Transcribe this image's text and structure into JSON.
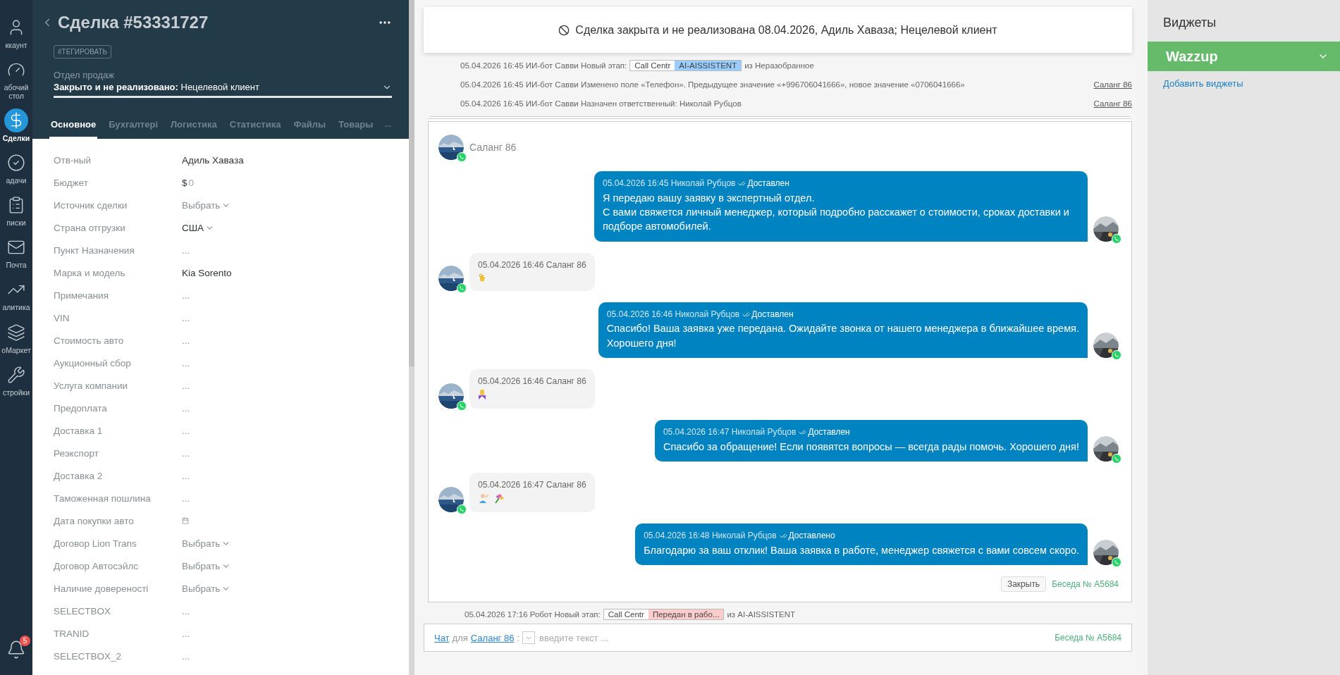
{
  "nav": {
    "items": [
      {
        "kind": "account",
        "label": "ккаунт",
        "selected": false
      },
      {
        "kind": "dashboard",
        "label": "абочий стол",
        "selected": false
      },
      {
        "kind": "deals",
        "label": "Сделки",
        "selected": true
      },
      {
        "kind": "tasks",
        "label": "адачи",
        "selected": false
      },
      {
        "kind": "lists",
        "label": "писки",
        "selected": false
      },
      {
        "kind": "mail",
        "label": "Почта",
        "selected": false
      },
      {
        "kind": "analytics",
        "label": "алитика",
        "selected": false
      },
      {
        "kind": "market",
        "label": "оМаркет",
        "selected": false
      },
      {
        "kind": "settings",
        "label": "стройки",
        "selected": false
      }
    ],
    "notifications": {
      "badge": "5"
    }
  },
  "deal": {
    "title": "Сделка #53331727",
    "tag_button": "#ТЕГИРОВАТЬ",
    "pipeline": "Отдел продаж",
    "status": "**Закрыто и не реализовано:** Нецелевой клиент",
    "tabs": [
      {
        "label": "Основное",
        "selected": true
      },
      {
        "label": "Бухгалтері",
        "selected": false
      },
      {
        "label": "Логистика",
        "selected": false
      },
      {
        "label": "Статистика",
        "selected": false
      },
      {
        "label": "Файлы",
        "selected": false
      },
      {
        "label": "Товары",
        "selected": false
      }
    ],
    "fields": [
      {
        "label": "Отв-ный",
        "kind": "text",
        "value": "Адиль Хаваза"
      },
      {
        "label": "Бюджет",
        "kind": "money",
        "currency": "$",
        "value": "0"
      },
      {
        "label": "Источник сделки",
        "kind": "select",
        "placeholder": "Выбрать"
      },
      {
        "label": "Страна отгрузки",
        "kind": "select_filled",
        "value": "США"
      },
      {
        "label": "Пункт Назначения",
        "kind": "empty",
        "value": "..."
      },
      {
        "label": "Марка и модель",
        "kind": "text",
        "value": "Kia Sorento"
      },
      {
        "label": "Примечания",
        "kind": "empty",
        "value": "..."
      },
      {
        "label": "VIN",
        "kind": "empty",
        "value": "..."
      },
      {
        "label": "Стоимость авто",
        "kind": "empty",
        "value": "..."
      },
      {
        "label": "Аукционный сбор",
        "kind": "empty",
        "value": "..."
      },
      {
        "label": "Услуга компании",
        "kind": "empty",
        "value": "..."
      },
      {
        "label": "Предоплата",
        "kind": "empty",
        "value": "..."
      },
      {
        "label": "Доставка 1",
        "kind": "empty",
        "value": "..."
      },
      {
        "label": "Реэкспорт",
        "kind": "empty",
        "value": "..."
      },
      {
        "label": "Доставка 2",
        "kind": "empty",
        "value": "..."
      },
      {
        "label": "Таможенная пошлина",
        "kind": "empty",
        "value": "..."
      },
      {
        "label": "Дата покупки авто",
        "kind": "date"
      },
      {
        "label": "Договор Lion Trans",
        "kind": "select",
        "placeholder": "Выбрать"
      },
      {
        "label": "Договор Автосэйлс",
        "kind": "select",
        "placeholder": "Выбрать"
      },
      {
        "label": "Наличие довереності",
        "kind": "select",
        "placeholder": "Выбрать"
      },
      {
        "label": "SELECTBOX",
        "kind": "empty",
        "value": "..."
      },
      {
        "label": "TRANID",
        "kind": "empty",
        "value": "..."
      },
      {
        "label": "SELECTBOX_2",
        "kind": "empty",
        "value": "..."
      }
    ]
  },
  "feed": {
    "notice": "Сделка закрыта и не реализована 08.04.2026, Адиль Хаваза; Нецелевой клиент",
    "events": [
      {
        "kind": "stage",
        "text": "05.04.2026 16:45 ИИ-бот Савви Новый этап:",
        "stages": [
          {
            "label": "Call Centr",
            "color": "#ffffff"
          },
          {
            "label": "AI-AISSISTENT",
            "color": "#99ccff"
          }
        ],
        "suffix": "из Неразобранное"
      },
      {
        "kind": "note",
        "text": "05.04.2026 16:45 ИИ-бот Савви Изменено поле «Телефон». Предыдущее значение «+996706041666», новое значение «0706041666»",
        "link": "Саланг 86"
      },
      {
        "kind": "note",
        "text": "05.04.2026 16:45 ИИ-бот Савви Назначен ответственный: Николай Рубцов",
        "link": "Саланг 86"
      }
    ],
    "chat": {
      "contact": "Саланг 86",
      "messages": [
        {
          "kind": "out",
          "meta": "05.04.2026 16:45 Николай Рубцов",
          "status": "Доставлен",
          "text": "Я передаю вашу заявку в экспертный отдел.\nС вами свяжется личный менеджер, который подробно расскажет о стоимости, сроках доставки и подборе автомобилей."
        },
        {
          "kind": "in",
          "meta": "05.04.2026 16:46 Саланг 86",
          "stickers": [
            {
              "kind": "hand"
            }
          ]
        },
        {
          "kind": "out",
          "meta": "05.04.2026 16:46 Николай Рубцов",
          "status": "Доставлен",
          "text": "Спасибо! Ваша заявка уже передана. Ожидайте звонка от нашего менеджера в ближайшее время.\nХорошего дня!"
        },
        {
          "kind": "in",
          "meta": "05.04.2026 16:46 Саланг 86",
          "stickers": [
            {
              "kind": "medal"
            }
          ]
        },
        {
          "kind": "out",
          "meta": "05.04.2026 16:47 Николай Рубцов",
          "status": "Доставлен",
          "text": "Спасибо за обращение! Если появятся вопросы — всегда рады помочь. Хорошего дня!"
        },
        {
          "kind": "in",
          "meta": "05.04.2026 16:47 Саланг 86",
          "stickers": [
            {
              "kind": "person"
            },
            {
              "kind": "flowers"
            }
          ]
        },
        {
          "kind": "out",
          "meta": "05.04.2026 16:48 Николай Рубцов",
          "status": "Доставлено",
          "text": "Благодарю за ваш отклик! Ваша заявка в работе, менеджер свяжется с вами совсем скоро."
        }
      ],
      "close_button": "Закрыть",
      "conversation": "Беседа № A5684"
    },
    "last_event": {
      "text": "05.04.2026 17:16 Робот Новый этап:",
      "stages": [
        {
          "label": "Call Centr",
          "color": "#ffffff"
        },
        {
          "label": "Передан в рабо...",
          "color": "#ffcccc"
        }
      ],
      "suffix": "из AI-AISSISTENT"
    },
    "composer": {
      "chat_link": "Чат",
      "for": "для",
      "contact_link": "Саланг 86",
      "colon": ":",
      "placeholder": "введите текст ...",
      "conversation": "Беседа № A5684"
    }
  },
  "widgets": {
    "title": "Виджеты",
    "items": [
      {
        "label": "Wazzup",
        "expanded": true
      }
    ],
    "add_link": "Добавить виджеты"
  }
}
